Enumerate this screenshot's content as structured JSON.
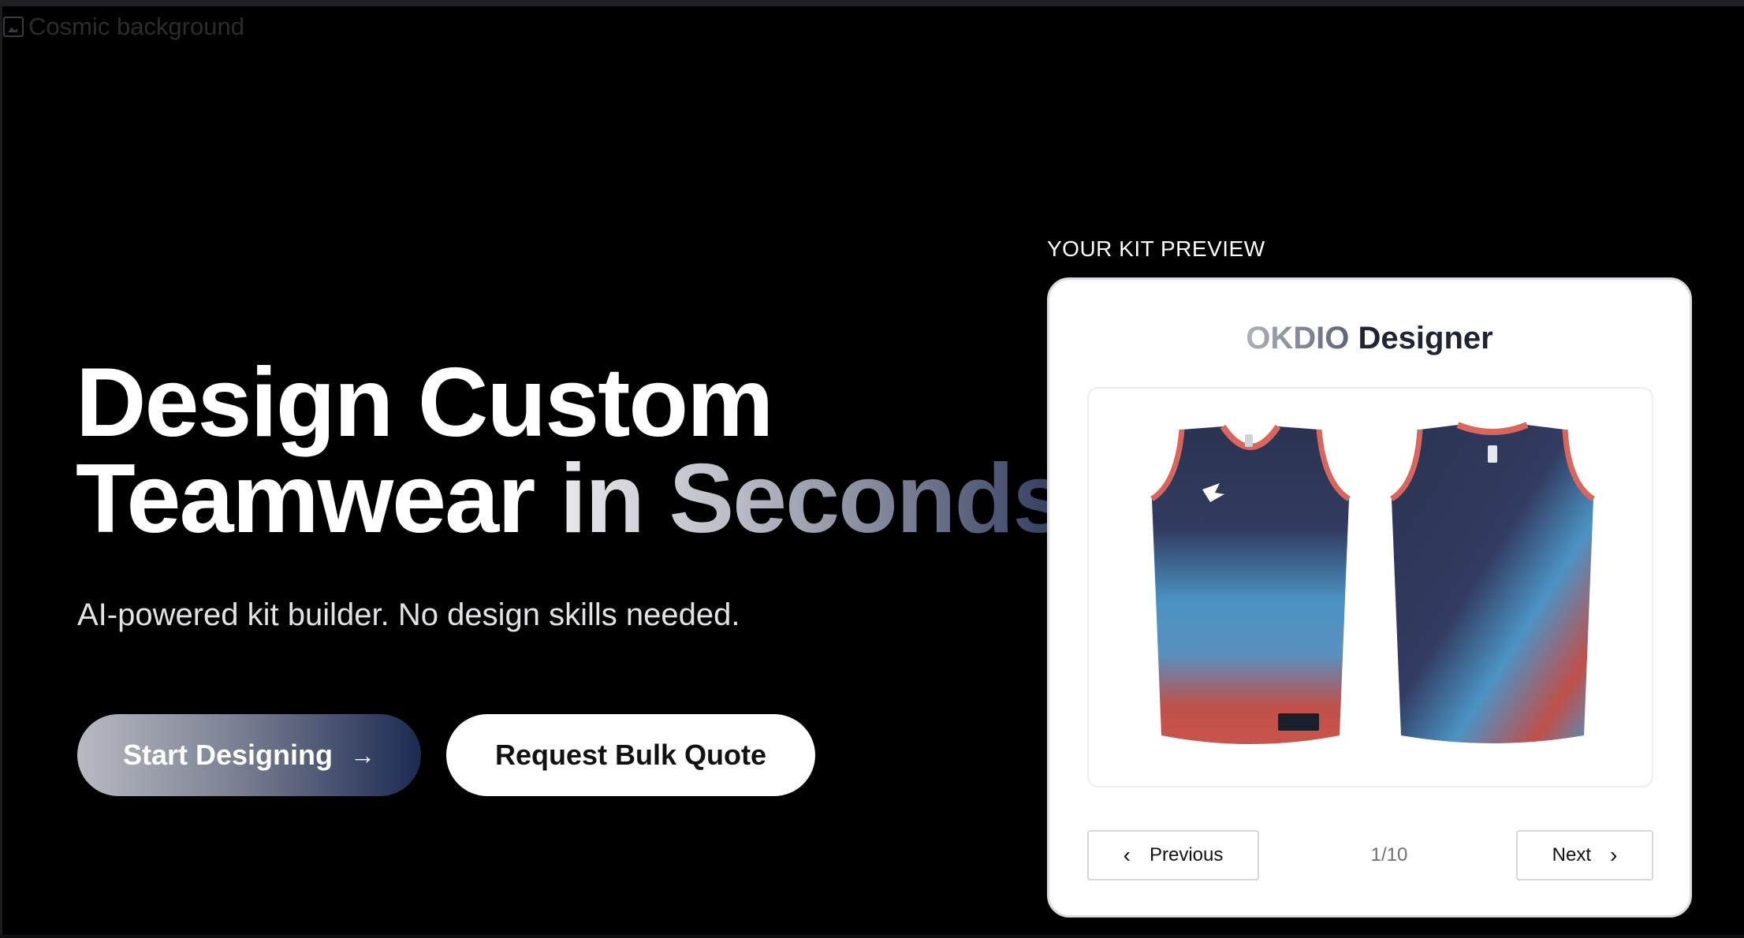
{
  "background": {
    "alt_text": "Cosmic background"
  },
  "hero": {
    "title_line1": "Design Custom",
    "title_line2_plain": "Teamwear",
    "title_line2_gradient": "in Seconds",
    "subtitle": "AI-powered kit builder. No design skills needed.",
    "primary_button": "Start Designing",
    "secondary_button": "Request Bulk Quote"
  },
  "preview": {
    "label": "YOUR KIT PREVIEW",
    "card_title_brand": "OKDIO",
    "card_title_rest": "Designer",
    "image_alt": "Basketball jersey front and back",
    "previous_label": "Previous",
    "next_label": "Next",
    "page_indicator": "1/10",
    "current_page": 1,
    "total_pages": 10
  },
  "colors": {
    "background": "#000000",
    "jersey_navy": "#2b3352",
    "jersey_blue": "#4b93c4",
    "jersey_red": "#c0504a",
    "trim_coral": "#d9665c"
  },
  "icons": {
    "primary_button_icon": "arrow-right-icon",
    "previous_icon": "chevron-left-icon",
    "next_icon": "chevron-right-icon",
    "broken_image_icon": "broken-image-icon"
  }
}
